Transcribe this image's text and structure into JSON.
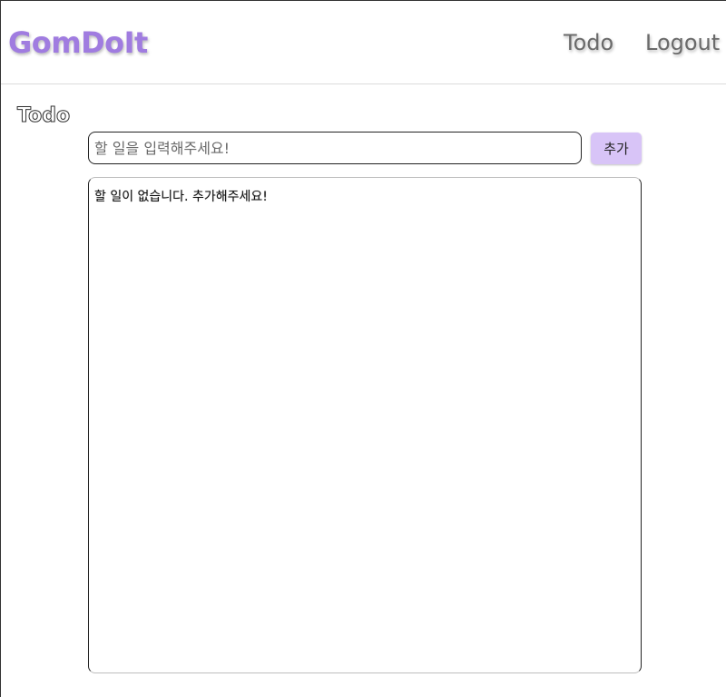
{
  "navbar": {
    "brand": "GomDoIt",
    "links": [
      {
        "label": "Todo"
      },
      {
        "label": "Logout"
      }
    ]
  },
  "page": {
    "title": "Todo"
  },
  "form": {
    "input_placeholder": "할 일을 입력해주세요!",
    "input_value": "",
    "add_label": "추가"
  },
  "list": {
    "empty_message": "할 일이 없습니다. 추가해주세요!"
  },
  "colors": {
    "brand": "#a07ce0",
    "add_button": "#d8c4f7"
  }
}
